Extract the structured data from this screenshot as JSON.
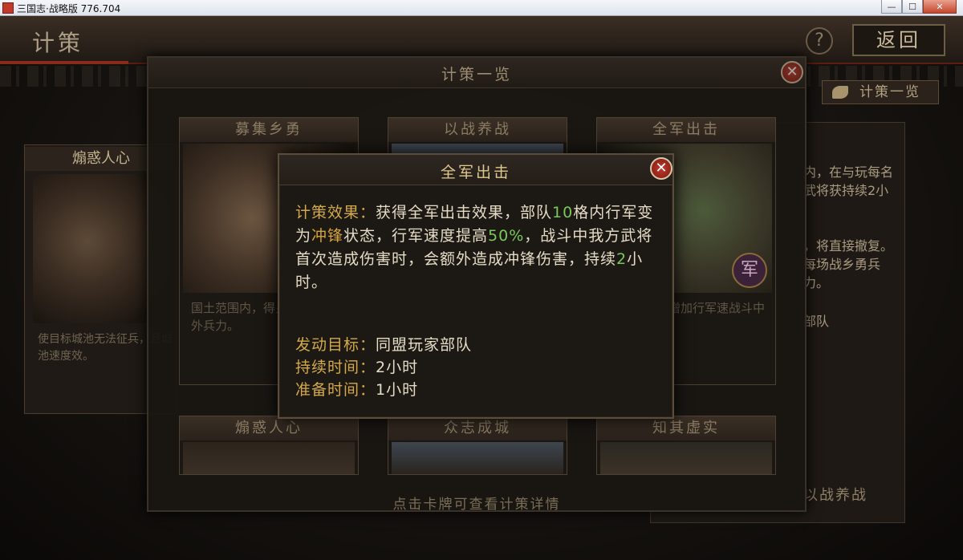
{
  "window": {
    "title": "三国志·战略版 776.704",
    "min_label": "—",
    "max_label": "☐",
    "close_label": "✕"
  },
  "header": {
    "page_title": "计策",
    "help_label": "?",
    "back_label": "返回",
    "tab_label": "计策一览"
  },
  "bg_left": {
    "title": "煽惑人心",
    "desc": "使目标城池无法征兵，且城池速度效。"
  },
  "bg_right": {
    "line1": "内，在与玩每名武将获持续2小",
    "line2": "，将直接撤复。每场战乡勇兵力。",
    "line3": "部队",
    "bottom": "以战养战"
  },
  "overview": {
    "title": "计策一览",
    "close_label": "✕",
    "footer": "点击卡牌可查看计策详情",
    "cards": [
      {
        "title": "募集乡勇",
        "desc": "国土范围内，得乡勇增援，额外兵力。"
      },
      {
        "title": "以战养战",
        "desc": ""
      },
      {
        "title": "全军出击",
        "desc": "格内获得冲增加行军速战斗中造成冲",
        "seal": "军"
      },
      {
        "title": "煽惑人心"
      },
      {
        "title": "众志成城"
      },
      {
        "title": "知其虚实"
      }
    ]
  },
  "detail": {
    "title": "全军出击",
    "close_label": "✕",
    "effect_label": "计策效果：",
    "effect_p1": "获得全军出击效果，部队",
    "effect_num1": "10",
    "effect_p2": "格内行军变为",
    "effect_hl": "冲锋",
    "effect_p3": "状态，行军速度提高",
    "effect_pct": "50%",
    "effect_p4": "，战斗中我方武将首次造成伤害时，会额外造成冲锋伤害，持续",
    "effect_num2": "2",
    "effect_p5": "小时。",
    "target_label": "发动目标：",
    "target_value": "同盟玩家部队",
    "duration_label": "持续时间：",
    "duration_value": "2小时",
    "prep_label": "准备时间：",
    "prep_value": "1小时"
  }
}
